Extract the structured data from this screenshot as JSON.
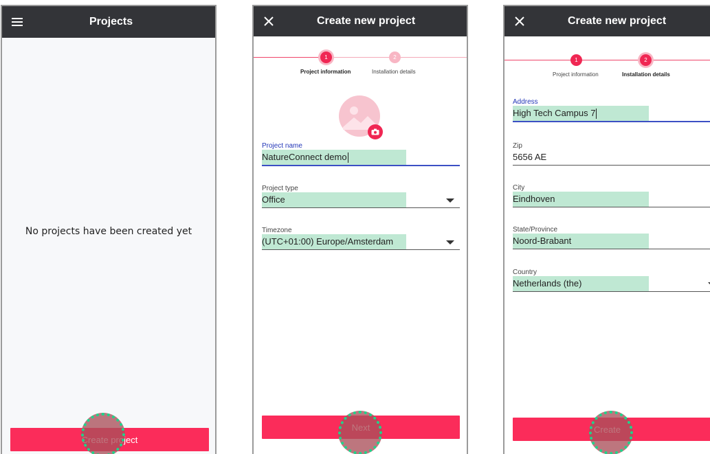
{
  "screen1": {
    "title": "Projects",
    "empty_message": "No projects have been created yet",
    "create_button": "Create project"
  },
  "screen2": {
    "title": "Create new project",
    "steps": [
      {
        "number": "1",
        "label": "Project information"
      },
      {
        "number": "2",
        "label": "Installation details"
      }
    ],
    "fields": {
      "project_name": {
        "label": "Project name",
        "value": "NatureConnect demo"
      },
      "project_type": {
        "label": "Project type",
        "value": "Office"
      },
      "timezone": {
        "label": "Timezone",
        "value": "(UTC+01:00) Europe/Amsterdam"
      }
    },
    "next_button": "Next"
  },
  "screen3": {
    "title": "Create new project",
    "steps": [
      {
        "number": "1",
        "label": "Project information"
      },
      {
        "number": "2",
        "label": "Installation details"
      }
    ],
    "fields": {
      "address": {
        "label": "Address",
        "value": "High Tech Campus 7"
      },
      "zip": {
        "label": "Zip",
        "value": "5656 AE"
      },
      "city": {
        "label": "City",
        "value": "Eindhoven"
      },
      "state": {
        "label": "State/Province",
        "value": "Noord-Brabant"
      },
      "country": {
        "label": "Country",
        "value": "Netherlands (the)"
      }
    },
    "create_button": "Create"
  },
  "colors": {
    "appbar": "#333438",
    "primary": "#fb2c5a",
    "highlight": "#bfe8d3",
    "focus": "#3b4fc4",
    "tap_ring": "#1fd48a"
  },
  "icons": {
    "menu": "menu-icon",
    "close": "close-icon",
    "image_placeholder": "image-placeholder-icon",
    "camera": "camera-icon",
    "dropdown": "chevron-down-icon"
  }
}
